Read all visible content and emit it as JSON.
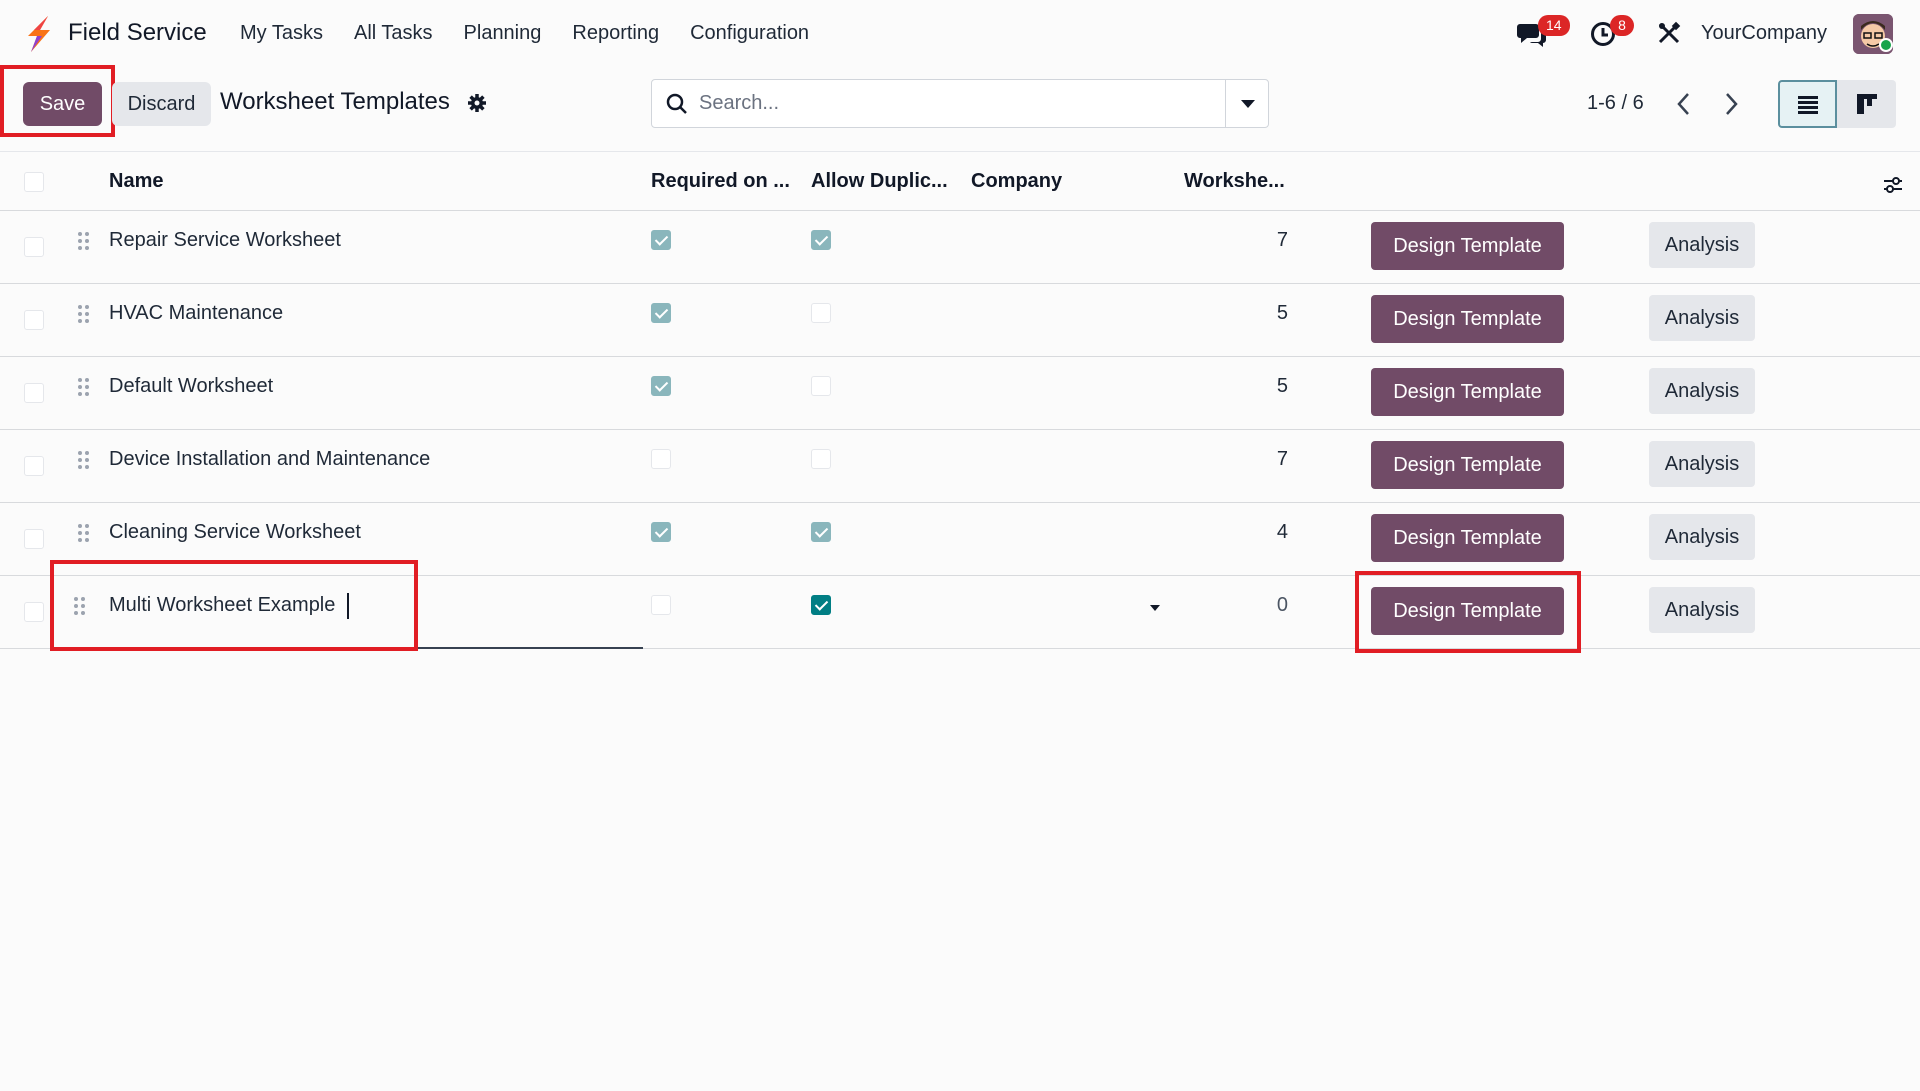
{
  "app": {
    "name": "Field Service",
    "menu": [
      "My Tasks",
      "All Tasks",
      "Planning",
      "Reporting",
      "Configuration"
    ],
    "chat_count": "14",
    "activity_count": "8",
    "company": "YourCompany"
  },
  "control": {
    "save_label": "Save",
    "discard_label": "Discard",
    "breadcrumb": "Worksheet Templates",
    "search_placeholder": "Search...",
    "pager": "1-6 / 6"
  },
  "table": {
    "columns": [
      "Name",
      "Required on ...",
      "Allow Duplic...",
      "Company",
      "Workshe..."
    ],
    "rows": [
      {
        "name": "Repair Service Worksheet",
        "required": true,
        "allow_duplicate": true,
        "company": "",
        "count": "7",
        "design": "Design Template",
        "analysis": "Analysis"
      },
      {
        "name": "HVAC Maintenance",
        "required": true,
        "allow_duplicate": false,
        "company": "",
        "count": "5",
        "design": "Design Template",
        "analysis": "Analysis"
      },
      {
        "name": "Default Worksheet",
        "required": true,
        "allow_duplicate": false,
        "company": "",
        "count": "5",
        "design": "Design Template",
        "analysis": "Analysis"
      },
      {
        "name": "Device Installation and Maintenance",
        "required": false,
        "allow_duplicate": false,
        "company": "",
        "count": "7",
        "design": "Design Template",
        "analysis": "Analysis"
      },
      {
        "name": "Cleaning Service Worksheet",
        "required": true,
        "allow_duplicate": true,
        "company": "",
        "count": "4",
        "design": "Design Template",
        "analysis": "Analysis"
      },
      {
        "name": "Multi Worksheet Example",
        "required": false,
        "allow_duplicate": true,
        "company": "",
        "count": "0",
        "design": "Design Template",
        "analysis": "Analysis"
      }
    ]
  },
  "colors": {
    "primary": "#714b67",
    "highlight": "#e11d24",
    "checkbox_checked": "#8ab6bc",
    "checkbox_active": "#017e84",
    "badge": "#dc2626"
  }
}
